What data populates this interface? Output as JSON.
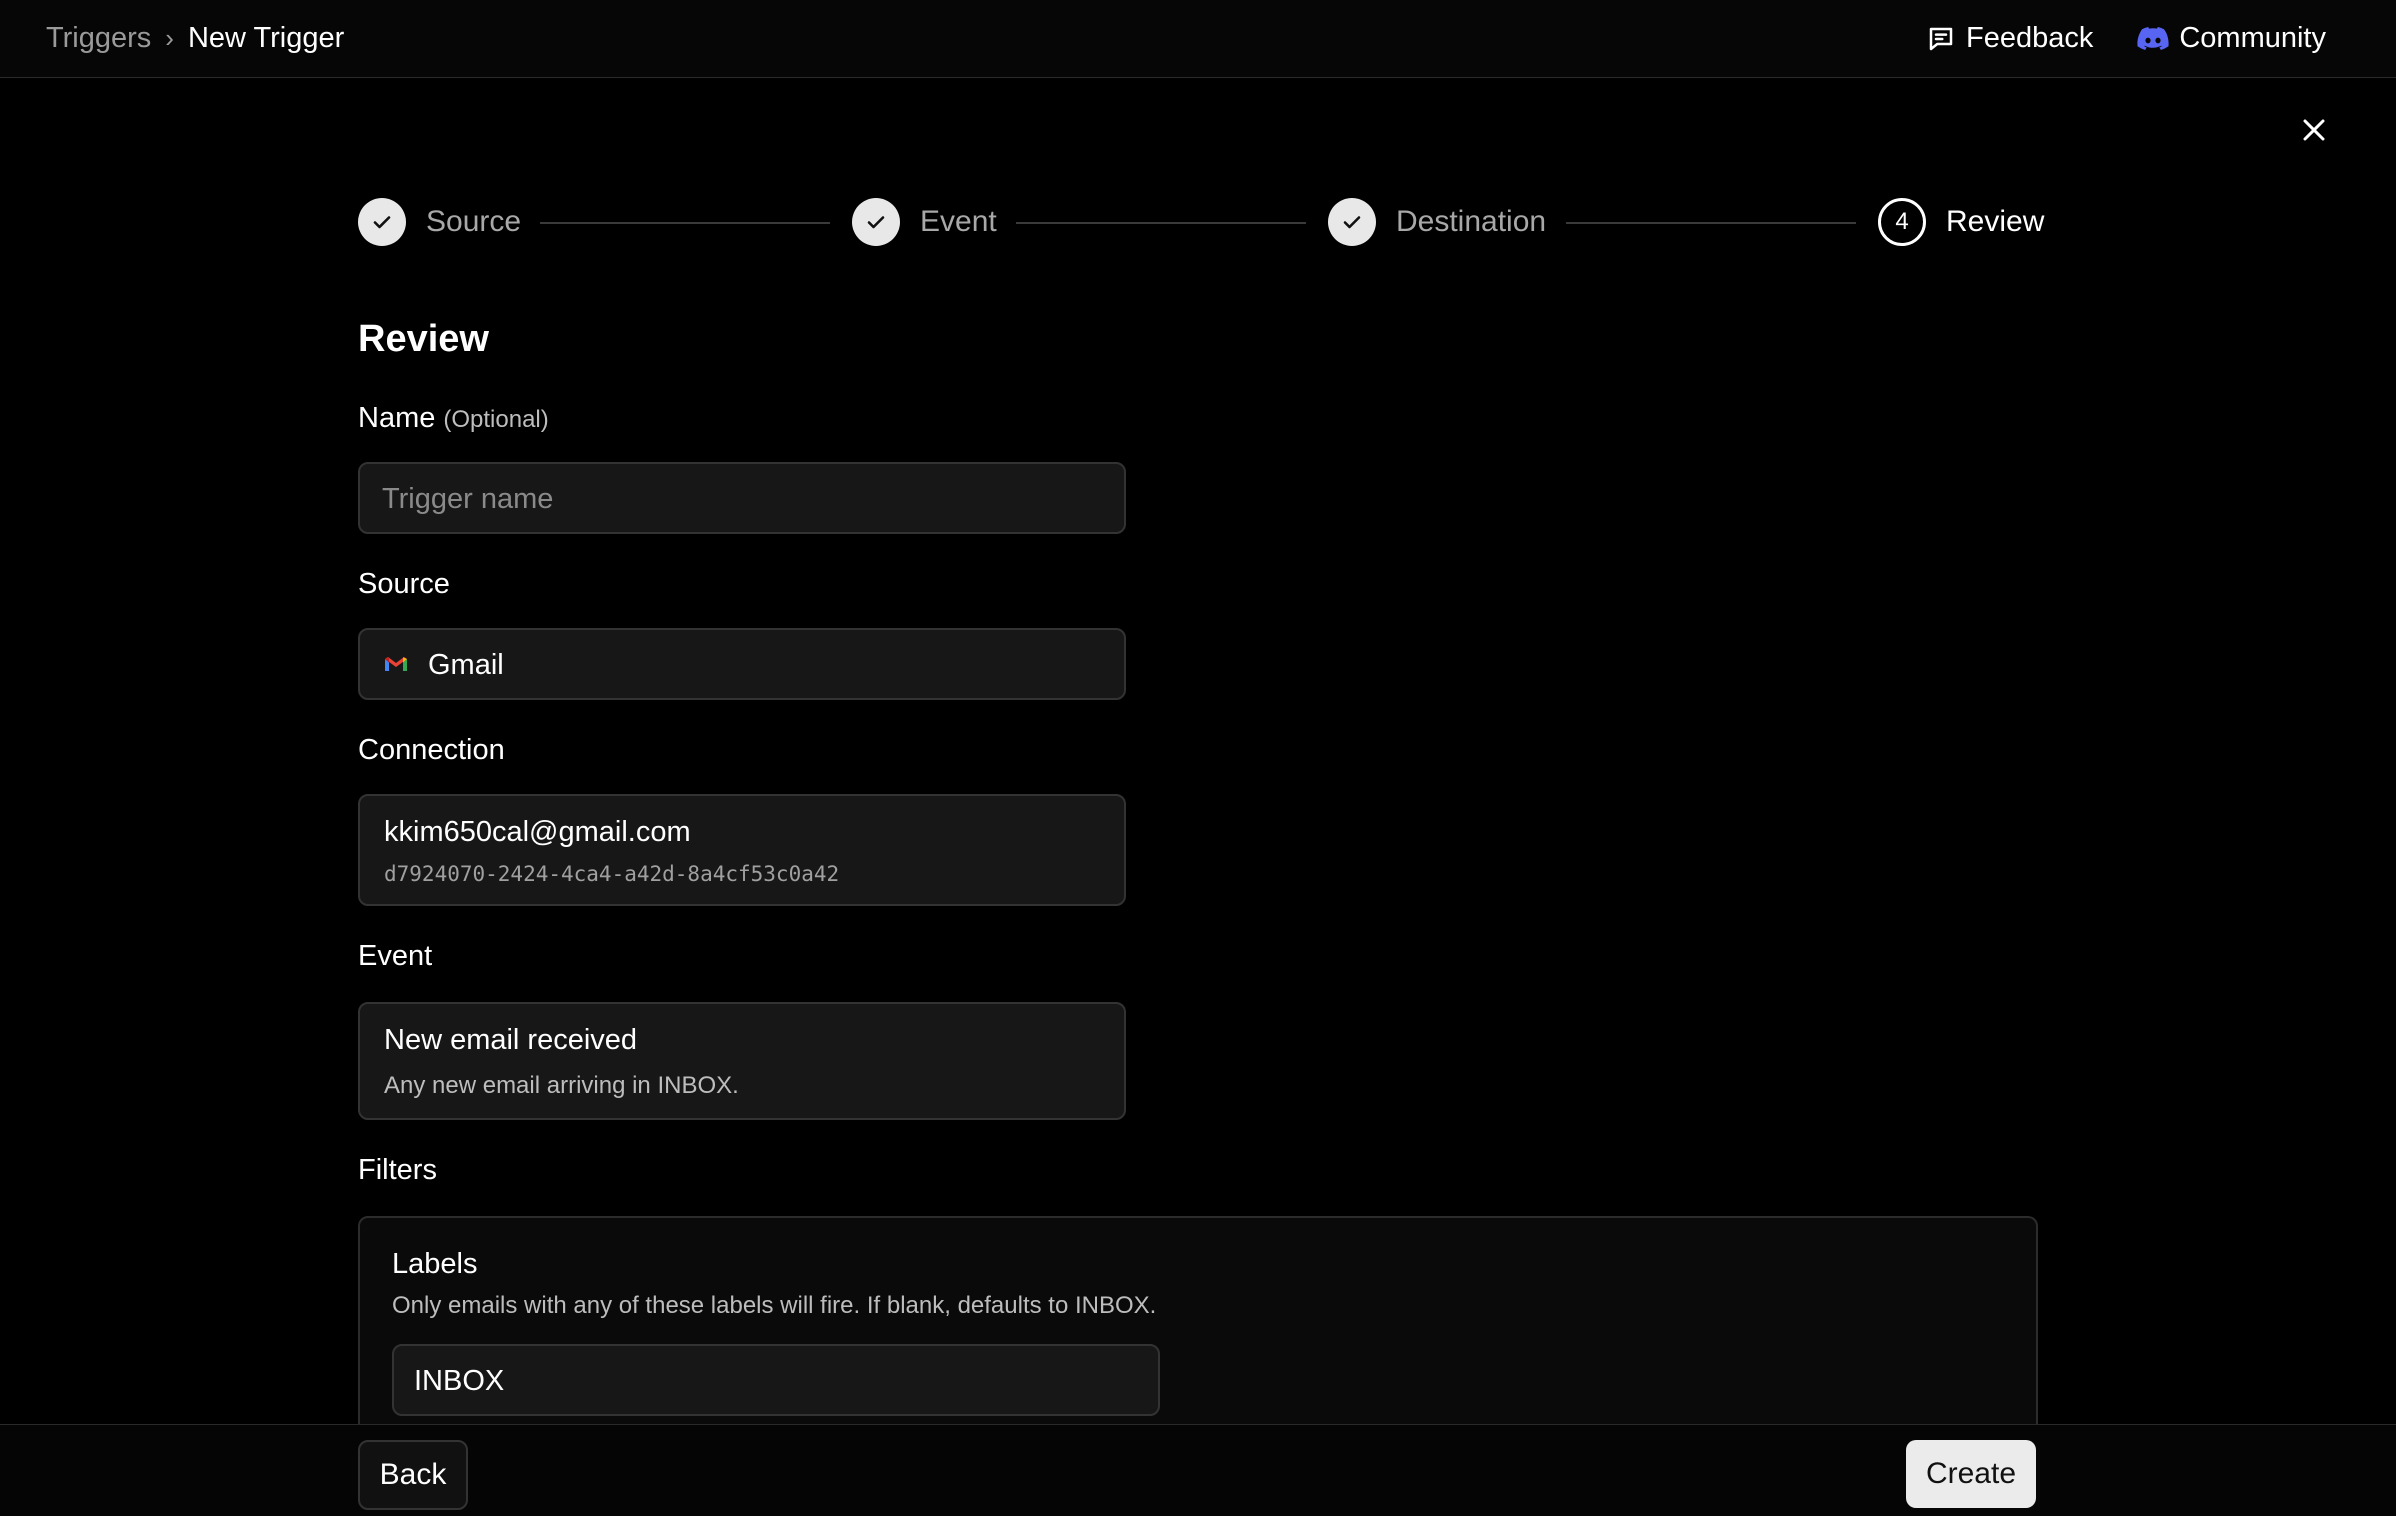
{
  "breadcrumb": {
    "root": "Triggers",
    "separator": "›",
    "current": "New Trigger"
  },
  "header": {
    "feedback_label": "Feedback",
    "community_label": "Community"
  },
  "stepper": {
    "steps": [
      {
        "label": "Source",
        "status": "done"
      },
      {
        "label": "Event",
        "status": "done"
      },
      {
        "label": "Destination",
        "status": "done"
      },
      {
        "label": "Review",
        "status": "current",
        "number": "4"
      }
    ]
  },
  "review": {
    "heading": "Review",
    "name": {
      "label": "Name",
      "optional": "(Optional)",
      "value": "",
      "placeholder": "Trigger name"
    },
    "source": {
      "label": "Source",
      "value": "Gmail",
      "icon": "gmail-icon"
    },
    "connection": {
      "label": "Connection",
      "email": "kkim650cal@gmail.com",
      "id": "d7924070-2424-4ca4-a42d-8a4cf53c0a42"
    },
    "event": {
      "label": "Event",
      "title": "New email received",
      "description": "Any new email arriving in INBOX."
    },
    "filters": {
      "label": "Filters",
      "labels": {
        "title": "Labels",
        "description": "Only emails with any of these labels will fire. If blank, defaults to INBOX.",
        "value": "INBOX"
      }
    }
  },
  "footer": {
    "back_label": "Back",
    "create_label": "Create"
  },
  "colors": {
    "background": "#000000",
    "panel": "#171717",
    "border": "#333333",
    "primary_button": "#ebebeb",
    "discord": "#5865F2"
  }
}
